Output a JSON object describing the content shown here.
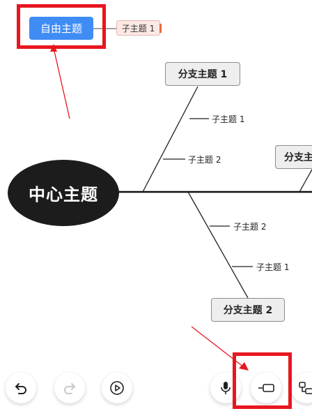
{
  "canvas": {
    "free_topic": "自由主题",
    "free_topic_child": "子主题 1",
    "central_topic": "中心主题",
    "branch_1": {
      "label": "分支主题 1",
      "children": [
        "子主题 1",
        "子主题 2"
      ]
    },
    "branch_2": {
      "label": "分支主题 2",
      "children": [
        "子主题 2",
        "子主题 1"
      ]
    },
    "branch_3": {
      "label": "分支主"
    }
  },
  "toolbar": {
    "buttons": [
      {
        "name": "undo",
        "icon": "undo-icon"
      },
      {
        "name": "redo",
        "icon": "redo-icon"
      },
      {
        "name": "play",
        "icon": "play-icon"
      },
      {
        "name": "voice",
        "icon": "microphone-icon"
      },
      {
        "name": "insert-topic",
        "icon": "insert-topic-icon"
      },
      {
        "name": "add-subtopic",
        "icon": "add-subtopic-icon"
      }
    ]
  },
  "colors": {
    "free_topic_bg": "#3f8cf4",
    "central_bg": "#1c1c1c",
    "annotation_red": "#e8161e",
    "child_pill_bg": "#fde8e4"
  }
}
